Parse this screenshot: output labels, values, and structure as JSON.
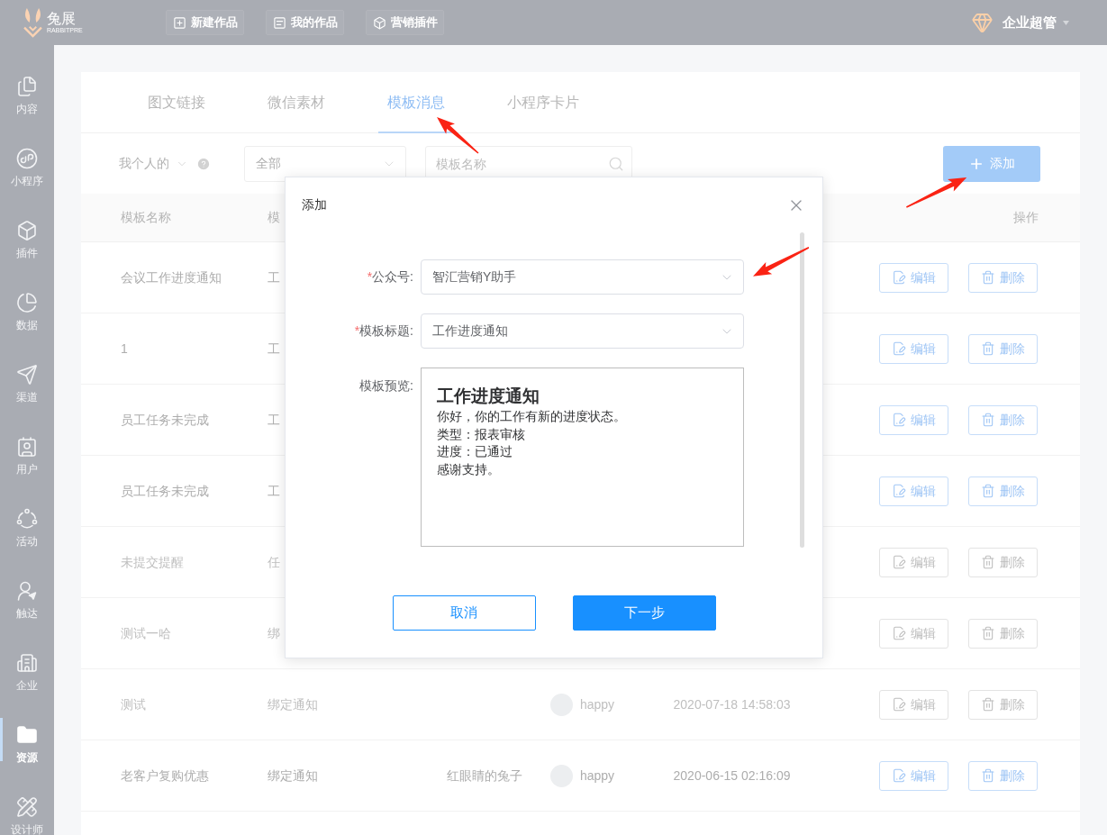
{
  "top_bar": {
    "logo": {
      "title": "兔展",
      "subtitle": "RABBITPRE"
    },
    "buttons": [
      {
        "label": "新建作品",
        "kind": "new"
      },
      {
        "label": "我的作品",
        "kind": "works"
      },
      {
        "label": "营销插件",
        "kind": "plugin"
      }
    ],
    "user_menu": {
      "label": "企业超管"
    }
  },
  "sidebar": {
    "items": [
      {
        "label": "内容",
        "kind": "content",
        "selected": false
      },
      {
        "label": "小程序",
        "kind": "miniprogram",
        "selected": false
      },
      {
        "label": "插件",
        "kind": "plugin",
        "selected": false
      },
      {
        "label": "数据",
        "kind": "data",
        "selected": false
      },
      {
        "label": "渠道",
        "kind": "channel",
        "selected": false
      },
      {
        "label": "用户",
        "kind": "user",
        "selected": false
      },
      {
        "label": "活动",
        "kind": "activity",
        "selected": false
      },
      {
        "label": "触达",
        "kind": "reach",
        "selected": false
      },
      {
        "label": "企业",
        "kind": "enterprise",
        "selected": false
      },
      {
        "label": "资源",
        "kind": "resource",
        "selected": true
      },
      {
        "label": "设计师",
        "kind": "designer",
        "selected": false
      }
    ]
  },
  "tabs": [
    {
      "label": "图文链接",
      "selected": false
    },
    {
      "label": "微信素材",
      "selected": false
    },
    {
      "label": "模板消息",
      "selected": true
    },
    {
      "label": "小程序卡片",
      "selected": false
    }
  ],
  "toolbar": {
    "scope": {
      "label": "我个人的"
    },
    "filter": {
      "value": "全部"
    },
    "search": {
      "placeholder": "模板名称"
    },
    "add_button": {
      "label": "添加"
    }
  },
  "table": {
    "columns": [
      {
        "label": "模板名称"
      },
      {
        "label": "模"
      },
      {
        "label": "操作"
      }
    ],
    "rows": [
      {
        "name": "会议工作进度通知",
        "column_2": "工",
        "disabled": false,
        "buttons": [
          {
            "label": "编辑",
            "kind": "edit"
          },
          {
            "label": "删除",
            "kind": "delete"
          }
        ]
      },
      {
        "name": "1",
        "column_2": "工",
        "disabled": false,
        "buttons": [
          {
            "label": "编辑",
            "kind": "edit"
          },
          {
            "label": "删除",
            "kind": "delete"
          }
        ]
      },
      {
        "name": "员工任务未完成",
        "column_2": "工",
        "disabled": false,
        "buttons": [
          {
            "label": "编辑",
            "kind": "edit"
          },
          {
            "label": "删除",
            "kind": "delete"
          }
        ]
      },
      {
        "name": "员工任务未完成",
        "column_2": "工",
        "disabled": false,
        "buttons": [
          {
            "label": "编辑",
            "kind": "edit"
          },
          {
            "label": "删除",
            "kind": "delete"
          }
        ]
      },
      {
        "name": "未提交提醒",
        "column_2": "任",
        "disabled": true,
        "buttons": [
          {
            "label": "编辑",
            "kind": "edit"
          },
          {
            "label": "删除",
            "kind": "delete"
          }
        ]
      },
      {
        "name": "测试一哈",
        "column_2": "绑",
        "disabled": true,
        "buttons": [
          {
            "label": "编辑",
            "kind": "edit"
          },
          {
            "label": "删除",
            "kind": "delete"
          }
        ]
      },
      {
        "name": "测试",
        "column_2": "绑定通知",
        "column_4": "happy",
        "column_5": "2020-07-18 14:58:03",
        "disabled": true,
        "buttons": [
          {
            "label": "编辑",
            "kind": "edit"
          },
          {
            "label": "删除",
            "kind": "delete"
          }
        ]
      },
      {
        "name": "老客户复购优惠",
        "column_2": "绑定通知",
        "column_3": "红眼睛的兔子",
        "column_4": "happy",
        "column_5": "2020-06-15 02:16:09",
        "disabled": false,
        "buttons": [
          {
            "label": "编辑",
            "kind": "edit"
          },
          {
            "label": "删除",
            "kind": "delete"
          }
        ]
      }
    ]
  },
  "dialog": {
    "title": "添加",
    "fields": [
      {
        "kind": "select",
        "required_mark": "*",
        "label": "公众号:",
        "value": "智汇营销Y助手"
      },
      {
        "kind": "select",
        "required_mark": "*",
        "label": "模板标题:",
        "value": "工作进度通知"
      },
      {
        "kind": "preview",
        "label": "模板预览:",
        "preview": {
          "title": "工作进度通知",
          "lines": [
            "你好，你的工作有新的进度状态。",
            "类型：报表审核",
            "进度：已通过",
            "感谢支持。"
          ]
        }
      }
    ],
    "buttons": [
      {
        "label": "取消",
        "kind": "secondary"
      },
      {
        "label": "下一步",
        "kind": "primary"
      }
    ]
  }
}
